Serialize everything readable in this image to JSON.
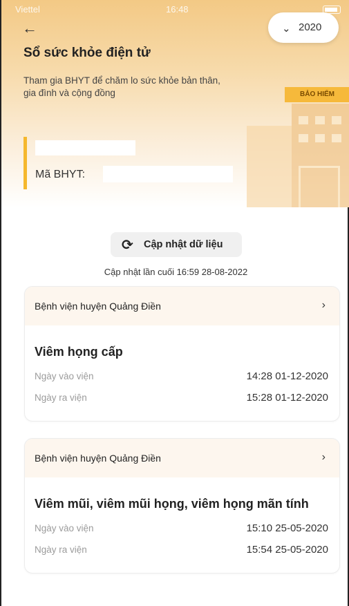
{
  "status_bar": {
    "carrier": "Viettel",
    "time": "16:48"
  },
  "header": {
    "title": "Sổ sức khỏe điện tử",
    "subtitle": "Tham gia BHYT để chăm lo sức khỏe bản thân, gia đình và cộng đồng",
    "year_selected": "2020",
    "insurance_sign": "BẢO HIỂM"
  },
  "member": {
    "bhyt_label": "Mã BHYT:"
  },
  "refresh": {
    "label": "Cập nhật dữ liệu",
    "last_updated": "Cập nhật lần cuối 16:59 28-08-2022"
  },
  "records": [
    {
      "hospital": "Bệnh viện huyện Quảng Điền",
      "diagnosis": "Viêm họng cấp",
      "admission_label": "Ngày vào viện",
      "admission_value": "14:28 01-12-2020",
      "discharge_label": "Ngày ra viện",
      "discharge_value": "15:28 01-12-2020"
    },
    {
      "hospital": "Bệnh viện huyện Quảng Điền",
      "diagnosis": "Viêm mũi, viêm mũi họng, viêm họng mãn tính",
      "admission_label": "Ngày vào viện",
      "admission_value": "15:10 25-05-2020",
      "discharge_label": "Ngày ra viện",
      "discharge_value": "15:54 25-05-2020"
    }
  ],
  "colors": {
    "accent": "#f5b82e",
    "header_top": "#f3c985"
  }
}
